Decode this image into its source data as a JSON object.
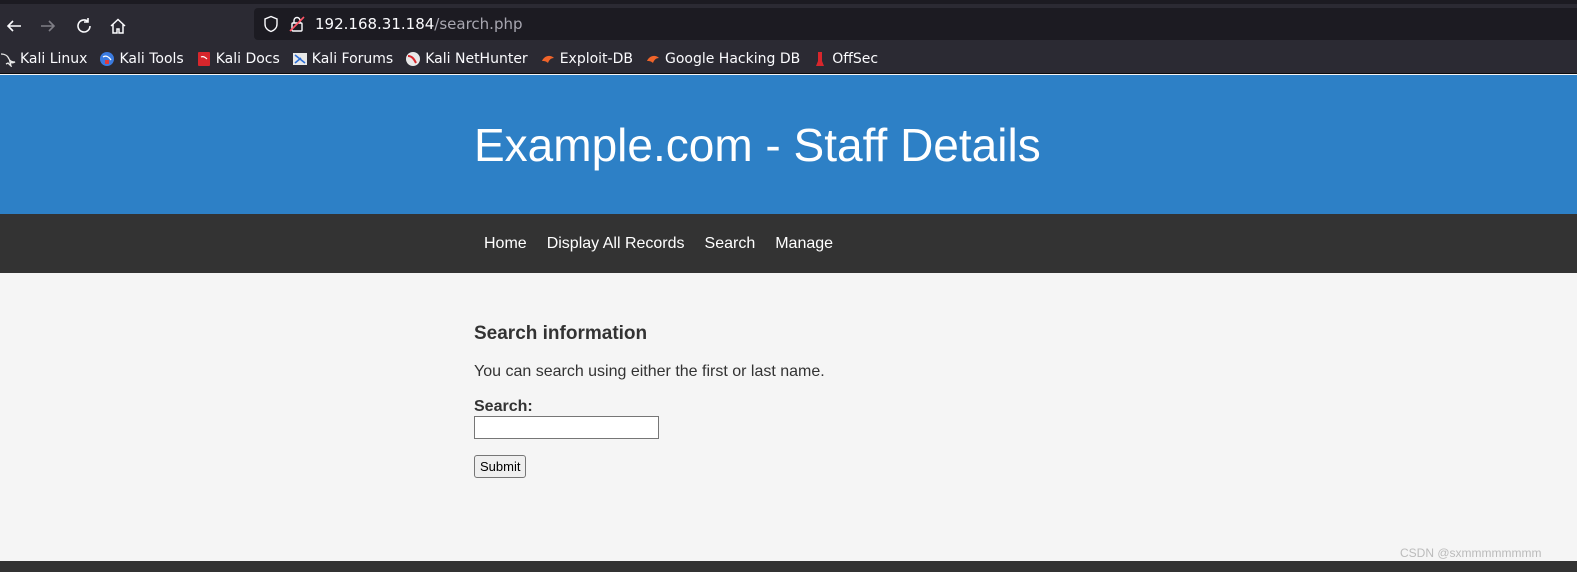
{
  "browser": {
    "url_host": "192.168.31.184",
    "url_path": "/search.php",
    "bookmarks": [
      {
        "label": "Kali Linux",
        "icon": "kali-dragon-icon"
      },
      {
        "label": "Kali Tools",
        "icon": "kali-tools-icon"
      },
      {
        "label": "Kali Docs",
        "icon": "kali-docs-icon"
      },
      {
        "label": "Kali Forums",
        "icon": "kali-forums-icon"
      },
      {
        "label": "Kali NetHunter",
        "icon": "kali-nethunter-icon"
      },
      {
        "label": "Exploit-DB",
        "icon": "exploit-db-icon"
      },
      {
        "label": "Google Hacking DB",
        "icon": "ghdb-icon"
      },
      {
        "label": "OffSec",
        "icon": "offsec-icon"
      }
    ]
  },
  "page": {
    "title": "Example.com - Staff Details",
    "nav": [
      "Home",
      "Display All Records",
      "Search",
      "Manage"
    ],
    "heading": "Search information",
    "intro": "You can search using either the first or last name.",
    "search_label": "Search:",
    "search_value": "",
    "submit_label": "Submit"
  },
  "watermark": "CSDN @sxmmmmmmmm",
  "colors": {
    "header_blue": "#2d80c6",
    "nav_dark": "#333333",
    "page_bg": "#f5f5f5",
    "browser_chrome": "#2b2a33"
  }
}
